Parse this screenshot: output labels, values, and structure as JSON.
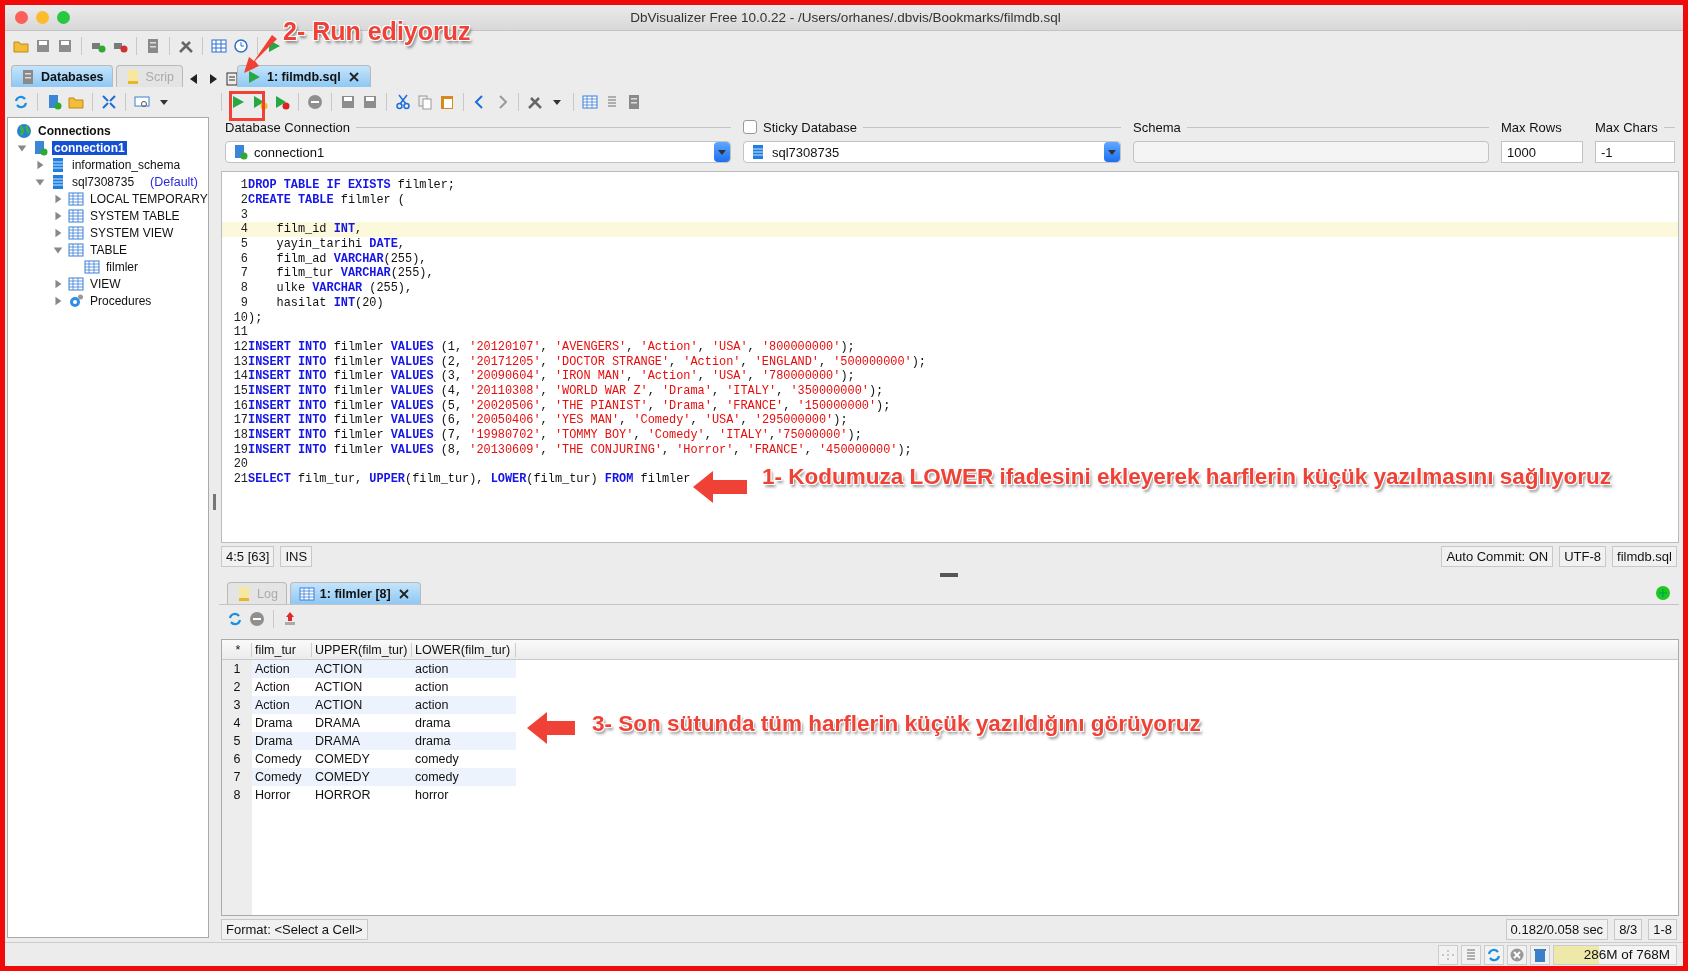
{
  "window": {
    "title": "DbVisualizer Free 10.0.22 - /Users/orhanes/.dbvis/Bookmarks/filmdb.sql"
  },
  "left_tabs": [
    {
      "label": "Databases",
      "selected": true
    },
    {
      "label": "Scrip",
      "selected": false
    }
  ],
  "editor_tab": {
    "label": "1: filmdb.sql"
  },
  "tree": {
    "label": "Connections",
    "children": [
      {
        "kind": "connection",
        "label": "connection1",
        "selected": true,
        "expanded": true,
        "children": [
          {
            "kind": "schema",
            "label": "information_schema",
            "selected": false,
            "expanded": false
          },
          {
            "kind": "schema",
            "label": "sql7308735",
            "note": "(Default)",
            "selected": false,
            "expanded": true,
            "children": [
              {
                "kind": "folder",
                "label": "LOCAL TEMPORARY",
                "selected": false,
                "expanded": false
              },
              {
                "kind": "folder",
                "label": "SYSTEM TABLE",
                "selected": false,
                "expanded": false
              },
              {
                "kind": "folder",
                "label": "SYSTEM VIEW",
                "selected": false,
                "expanded": false
              },
              {
                "kind": "folder",
                "label": "TABLE",
                "selected": false,
                "expanded": true,
                "children": [
                  {
                    "kind": "table",
                    "label": "filmler",
                    "selected": false
                  }
                ]
              },
              {
                "kind": "folder",
                "label": "VIEW",
                "selected": false,
                "expanded": false
              },
              {
                "kind": "procedures",
                "label": "Procedures",
                "selected": false,
                "expanded": false
              }
            ]
          }
        ]
      }
    ]
  },
  "connection_bar": {
    "connection_label": "Database Connection",
    "connection_value": "connection1",
    "sticky_label": "Sticky Database",
    "sticky_checked": false,
    "catalog_value": "sql7308735",
    "schema_label": "Schema",
    "max_rows_label": "Max Rows",
    "max_rows_value": "1000",
    "max_chars_label": "Max Chars",
    "max_chars_value": "-1"
  },
  "editor": {
    "lines": [
      {
        "number": "1",
        "highlighted": false,
        "segments": [
          {
            "kind": "keyword",
            "text": "DROP TABLE IF EXISTS"
          },
          {
            "kind": "plain",
            "text": " filmler;"
          }
        ]
      },
      {
        "number": "2",
        "highlighted": false,
        "segments": [
          {
            "kind": "keyword",
            "text": "CREATE TABLE"
          },
          {
            "kind": "plain",
            "text": " filmler ("
          }
        ]
      },
      {
        "number": "3",
        "highlighted": false
      },
      {
        "number": "4",
        "highlighted": true,
        "segments": [
          {
            "kind": "plain",
            "text": "    film_id "
          },
          {
            "kind": "keyword",
            "text": "INT"
          },
          {
            "kind": "plain",
            "text": ","
          }
        ]
      },
      {
        "number": "5",
        "highlighted": false,
        "segments": [
          {
            "kind": "plain",
            "text": "    yayin_tarihi "
          },
          {
            "kind": "keyword",
            "text": "DATE"
          },
          {
            "kind": "plain",
            "text": ","
          }
        ]
      },
      {
        "number": "6",
        "highlighted": false,
        "segments": [
          {
            "kind": "plain",
            "text": "    film_ad "
          },
          {
            "kind": "keyword",
            "text": "VARCHAR"
          },
          {
            "kind": "plain",
            "text": "(255),"
          }
        ]
      },
      {
        "number": "7",
        "highlighted": false,
        "segments": [
          {
            "kind": "plain",
            "text": "    film_tur "
          },
          {
            "kind": "keyword",
            "text": "VARCHAR"
          },
          {
            "kind": "plain",
            "text": "(255),"
          }
        ]
      },
      {
        "number": "8",
        "highlighted": false,
        "segments": [
          {
            "kind": "plain",
            "text": "    ulke "
          },
          {
            "kind": "keyword",
            "text": "VARCHAR"
          },
          {
            "kind": "plain",
            "text": " (255),"
          }
        ]
      },
      {
        "number": "9",
        "highlighted": false,
        "segments": [
          {
            "kind": "plain",
            "text": "    hasilat "
          },
          {
            "kind": "keyword",
            "text": "INT"
          },
          {
            "kind": "plain",
            "text": "(20)"
          }
        ]
      },
      {
        "number": "10",
        "highlighted": false,
        "segments": [
          {
            "kind": "plain",
            "text": ");"
          }
        ]
      },
      {
        "number": "11",
        "highlighted": false
      },
      {
        "number": "12",
        "highlighted": false,
        "segments": [
          {
            "kind": "keyword",
            "text": "INSERT INTO"
          },
          {
            "kind": "plain",
            "text": " filmler "
          },
          {
            "kind": "keyword",
            "text": "VALUES"
          },
          {
            "kind": "plain",
            "text": " (1, "
          },
          {
            "kind": "string",
            "text": "'20120107'"
          },
          {
            "kind": "plain",
            "text": ", "
          },
          {
            "kind": "string",
            "text": "'AVENGERS'"
          },
          {
            "kind": "plain",
            "text": ", "
          },
          {
            "kind": "string",
            "text": "'Action'"
          },
          {
            "kind": "plain",
            "text": ", "
          },
          {
            "kind": "string",
            "text": "'USA'"
          },
          {
            "kind": "plain",
            "text": ", "
          },
          {
            "kind": "string",
            "text": "'800000000'"
          },
          {
            "kind": "plain",
            "text": ");"
          }
        ]
      },
      {
        "number": "13",
        "highlighted": false,
        "segments": [
          {
            "kind": "keyword",
            "text": "INSERT INTO"
          },
          {
            "kind": "plain",
            "text": " filmler "
          },
          {
            "kind": "keyword",
            "text": "VALUES"
          },
          {
            "kind": "plain",
            "text": " (2, "
          },
          {
            "kind": "string",
            "text": "'20171205'"
          },
          {
            "kind": "plain",
            "text": ", "
          },
          {
            "kind": "string",
            "text": "'DOCTOR STRANGE'"
          },
          {
            "kind": "plain",
            "text": ", "
          },
          {
            "kind": "string",
            "text": "'Action'"
          },
          {
            "kind": "plain",
            "text": ", "
          },
          {
            "kind": "string",
            "text": "'ENGLAND'"
          },
          {
            "kind": "plain",
            "text": ", "
          },
          {
            "kind": "string",
            "text": "'500000000'"
          },
          {
            "kind": "plain",
            "text": ");"
          }
        ]
      },
      {
        "number": "14",
        "highlighted": false,
        "segments": [
          {
            "kind": "keyword",
            "text": "INSERT INTO"
          },
          {
            "kind": "plain",
            "text": " filmler "
          },
          {
            "kind": "keyword",
            "text": "VALUES"
          },
          {
            "kind": "plain",
            "text": " (3, "
          },
          {
            "kind": "string",
            "text": "'20090604'"
          },
          {
            "kind": "plain",
            "text": ", "
          },
          {
            "kind": "string",
            "text": "'IRON MAN'"
          },
          {
            "kind": "plain",
            "text": ", "
          },
          {
            "kind": "string",
            "text": "'Action'"
          },
          {
            "kind": "plain",
            "text": ", "
          },
          {
            "kind": "string",
            "text": "'USA'"
          },
          {
            "kind": "plain",
            "text": ", "
          },
          {
            "kind": "string",
            "text": "'780000000'"
          },
          {
            "kind": "plain",
            "text": ");"
          }
        ]
      },
      {
        "number": "15",
        "highlighted": false,
        "segments": [
          {
            "kind": "keyword",
            "text": "INSERT INTO"
          },
          {
            "kind": "plain",
            "text": " filmler "
          },
          {
            "kind": "keyword",
            "text": "VALUES"
          },
          {
            "kind": "plain",
            "text": " (4, "
          },
          {
            "kind": "string",
            "text": "'20110308'"
          },
          {
            "kind": "plain",
            "text": ", "
          },
          {
            "kind": "string",
            "text": "'WORLD WAR Z'"
          },
          {
            "kind": "plain",
            "text": ", "
          },
          {
            "kind": "string",
            "text": "'Drama'"
          },
          {
            "kind": "plain",
            "text": ", "
          },
          {
            "kind": "string",
            "text": "'ITALY'"
          },
          {
            "kind": "plain",
            "text": ", "
          },
          {
            "kind": "string",
            "text": "'350000000'"
          },
          {
            "kind": "plain",
            "text": ");"
          }
        ]
      },
      {
        "number": "16",
        "highlighted": false,
        "segments": [
          {
            "kind": "keyword",
            "text": "INSERT INTO"
          },
          {
            "kind": "plain",
            "text": " filmler "
          },
          {
            "kind": "keyword",
            "text": "VALUES"
          },
          {
            "kind": "plain",
            "text": " (5, "
          },
          {
            "kind": "string",
            "text": "'20020506'"
          },
          {
            "kind": "plain",
            "text": ", "
          },
          {
            "kind": "string",
            "text": "'THE PIANIST'"
          },
          {
            "kind": "plain",
            "text": ", "
          },
          {
            "kind": "string",
            "text": "'Drama'"
          },
          {
            "kind": "plain",
            "text": ", "
          },
          {
            "kind": "string",
            "text": "'FRANCE'"
          },
          {
            "kind": "plain",
            "text": ", "
          },
          {
            "kind": "string",
            "text": "'150000000'"
          },
          {
            "kind": "plain",
            "text": ");"
          }
        ]
      },
      {
        "number": "17",
        "highlighted": false,
        "segments": [
          {
            "kind": "keyword",
            "text": "INSERT INTO"
          },
          {
            "kind": "plain",
            "text": " filmler "
          },
          {
            "kind": "keyword",
            "text": "VALUES"
          },
          {
            "kind": "plain",
            "text": " (6, "
          },
          {
            "kind": "string",
            "text": "'20050406'"
          },
          {
            "kind": "plain",
            "text": ", "
          },
          {
            "kind": "string",
            "text": "'YES MAN'"
          },
          {
            "kind": "plain",
            "text": ", "
          },
          {
            "kind": "string",
            "text": "'Comedy'"
          },
          {
            "kind": "plain",
            "text": ", "
          },
          {
            "kind": "string",
            "text": "'USA'"
          },
          {
            "kind": "plain",
            "text": ", "
          },
          {
            "kind": "string",
            "text": "'295000000'"
          },
          {
            "kind": "plain",
            "text": ");"
          }
        ]
      },
      {
        "number": "18",
        "highlighted": false,
        "segments": [
          {
            "kind": "keyword",
            "text": "INSERT INTO"
          },
          {
            "kind": "plain",
            "text": " filmler "
          },
          {
            "kind": "keyword",
            "text": "VALUES"
          },
          {
            "kind": "plain",
            "text": " (7, "
          },
          {
            "kind": "string",
            "text": "'19980702'"
          },
          {
            "kind": "plain",
            "text": ", "
          },
          {
            "kind": "string",
            "text": "'TOMMY BOY'"
          },
          {
            "kind": "plain",
            "text": ", "
          },
          {
            "kind": "string",
            "text": "'Comedy'"
          },
          {
            "kind": "plain",
            "text": ", "
          },
          {
            "kind": "string",
            "text": "'ITALY'"
          },
          {
            "kind": "plain",
            "text": ","
          },
          {
            "kind": "string",
            "text": "'75000000'"
          },
          {
            "kind": "plain",
            "text": ");"
          }
        ]
      },
      {
        "number": "19",
        "highlighted": false,
        "segments": [
          {
            "kind": "keyword",
            "text": "INSERT INTO"
          },
          {
            "kind": "plain",
            "text": " filmler "
          },
          {
            "kind": "keyword",
            "text": "VALUES"
          },
          {
            "kind": "plain",
            "text": " (8, "
          },
          {
            "kind": "string",
            "text": "'20130609'"
          },
          {
            "kind": "plain",
            "text": ", "
          },
          {
            "kind": "string",
            "text": "'THE CONJURING'"
          },
          {
            "kind": "plain",
            "text": ", "
          },
          {
            "kind": "string",
            "text": "'Horror'"
          },
          {
            "kind": "plain",
            "text": ", "
          },
          {
            "kind": "string",
            "text": "'FRANCE'"
          },
          {
            "kind": "plain",
            "text": ", "
          },
          {
            "kind": "string",
            "text": "'450000000'"
          },
          {
            "kind": "plain",
            "text": ");"
          }
        ]
      },
      {
        "number": "20",
        "highlighted": false
      },
      {
        "number": "21",
        "highlighted": false,
        "segments": [
          {
            "kind": "keyword",
            "text": "SELECT"
          },
          {
            "kind": "plain",
            "text": " film_tur, "
          },
          {
            "kind": "keyword",
            "text": "UPPER"
          },
          {
            "kind": "plain",
            "text": "(film_tur), "
          },
          {
            "kind": "keyword",
            "text": "LOWER"
          },
          {
            "kind": "plain",
            "text": "(film_tur) "
          },
          {
            "kind": "keyword",
            "text": "FROM"
          },
          {
            "kind": "plain",
            "text": " filmler"
          }
        ]
      }
    ]
  },
  "editor_status": {
    "position": "4:5 [63]",
    "mode": "INS",
    "auto_commit": "Auto Commit: ON",
    "encoding": "UTF-8",
    "file": "filmdb.sql"
  },
  "result_tabs": [
    {
      "label": "Log",
      "selected": false
    },
    {
      "label": "1: filmler [8]",
      "selected": true
    }
  ],
  "results": {
    "corner": "*",
    "columns": [
      "film_tur",
      "UPPER(film_tur)",
      "LOWER(film_tur)"
    ],
    "rows": [
      {
        "number": "1",
        "cells": [
          "Action",
          "ACTION",
          "action"
        ]
      },
      {
        "number": "2",
        "cells": [
          "Action",
          "ACTION",
          "action"
        ]
      },
      {
        "number": "3",
        "cells": [
          "Action",
          "ACTION",
          "action"
        ]
      },
      {
        "number": "4",
        "cells": [
          "Drama",
          "DRAMA",
          "drama"
        ]
      },
      {
        "number": "5",
        "cells": [
          "Drama",
          "DRAMA",
          "drama"
        ]
      },
      {
        "number": "6",
        "cells": [
          "Comedy",
          "COMEDY",
          "comedy"
        ]
      },
      {
        "number": "7",
        "cells": [
          "Comedy",
          "COMEDY",
          "comedy"
        ]
      },
      {
        "number": "8",
        "cells": [
          "Horror",
          "HORROR",
          "horror"
        ]
      }
    ]
  },
  "result_status": {
    "format": "Format: <Select a Cell>",
    "timing": "0.182/0.058 sec",
    "count": "8/3",
    "range": "1-8"
  },
  "memory": {
    "text": "286M of 768M",
    "level": 0.37
  },
  "annotations": [
    {
      "text": "2- Run ediyoruz"
    },
    {
      "text": "1- Kodumuza LOWER ifadesini ekleyerek harflerin küçük yazılmasını sağlıyoruz"
    },
    {
      "text": "3- Son sütunda tüm harflerin küçük yazıldığını görüyoruz"
    }
  ]
}
